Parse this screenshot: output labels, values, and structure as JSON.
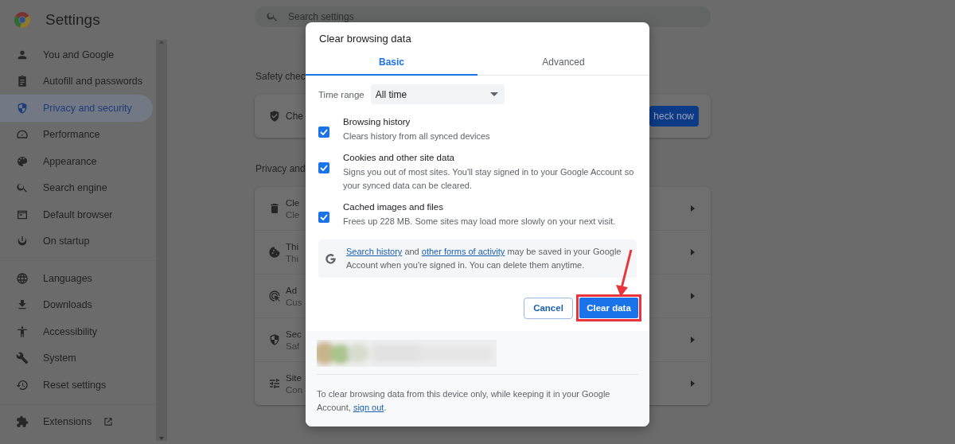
{
  "sidebar": {
    "title": "Settings",
    "groups": [
      [
        {
          "label": "You and Google",
          "selected": false
        },
        {
          "label": "Autofill and passwords",
          "selected": false
        },
        {
          "label": "Privacy and security",
          "selected": true
        },
        {
          "label": "Performance",
          "selected": false
        },
        {
          "label": "Appearance",
          "selected": false
        },
        {
          "label": "Search engine",
          "selected": false
        },
        {
          "label": "Default browser",
          "selected": false
        },
        {
          "label": "On startup",
          "selected": false
        }
      ],
      [
        {
          "label": "Languages",
          "selected": false
        },
        {
          "label": "Downloads",
          "selected": false
        },
        {
          "label": "Accessibility",
          "selected": false
        },
        {
          "label": "System",
          "selected": false
        },
        {
          "label": "Reset settings",
          "selected": false
        }
      ],
      [
        {
          "label": "Extensions",
          "selected": false,
          "external": true
        }
      ]
    ]
  },
  "search": {
    "placeholder": "Search settings"
  },
  "safety_check": {
    "heading": "Safety chec",
    "text": "Che",
    "button": "heck now"
  },
  "privacy": {
    "heading": "Privacy and",
    "rows": [
      {
        "title": "Cle",
        "subtitle": "Cle"
      },
      {
        "title": "Thi",
        "subtitle": "Thi"
      },
      {
        "title": "Ad",
        "subtitle": "Cus"
      },
      {
        "title": "Sec",
        "subtitle": "Saf"
      },
      {
        "title": "Site",
        "subtitle": "Con"
      }
    ]
  },
  "dialog": {
    "title": "Clear browsing data",
    "tabs": [
      {
        "label": "Basic",
        "selected": true
      },
      {
        "label": "Advanced",
        "selected": false
      }
    ],
    "time_range": {
      "label": "Time range",
      "value": "All time"
    },
    "options": [
      {
        "title": "Browsing history",
        "description": "Clears history from all synced devices",
        "checked": true
      },
      {
        "title": "Cookies and other site data",
        "description": "Signs you out of most sites. You'll stay signed in to your Google Account so your synced data can be cleared.",
        "checked": true
      },
      {
        "title": "Cached images and files",
        "description": "Frees up 228 MB. Some sites may load more slowly on your next visit.",
        "checked": true
      }
    ],
    "info": {
      "link_1": "Search history",
      "and": "and",
      "link_2": "other forms of activity",
      "rest": "may be saved in your Google Account when you're signed in. You can delete them anytime."
    },
    "buttons": {
      "cancel": "Cancel",
      "confirm": "Clear data"
    },
    "footer": {
      "text": "To clear browsing data from this device only, while keeping it in your Google Account,",
      "link": "sign out",
      "end": "."
    }
  }
}
